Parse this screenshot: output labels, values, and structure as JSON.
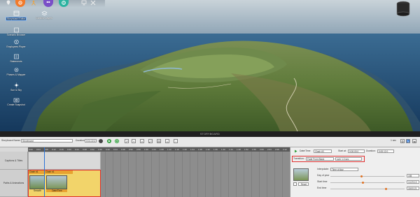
{
  "top_toolbar": {
    "buttons": [
      {
        "icon": "map-pin-icon",
        "color": "#e8e8e8"
      },
      {
        "icon": "gear-icon",
        "color": "#f27a2a"
      },
      {
        "icon": "person-icon",
        "color": "#e8a64a"
      },
      {
        "icon": "people-icon",
        "color": "#7a4fc7"
      },
      {
        "icon": "globe-icon",
        "color": "#2bb3a0"
      },
      {
        "icon": "monitor-icon",
        "color": "#e0e0e0"
      },
      {
        "icon": "tools-icon",
        "color": "#e0e0e0"
      }
    ]
  },
  "tools": [
    {
      "label": "Storyboard Editor",
      "icon": "storyboard-icon",
      "selected": true
    },
    {
      "label": "Confuse Layers",
      "icon": "layers-icon",
      "selected": false
    },
    {
      "label": "Scenario Browser",
      "icon": "browser-icon",
      "selected": false
    },
    {
      "label": "Employees Player",
      "icon": "player-icon",
      "selected": false
    },
    {
      "label": "Statements",
      "icon": "statements-icon",
      "selected": false
    },
    {
      "label": "Phases & Mapper",
      "icon": "phases-icon",
      "selected": false
    },
    {
      "label": "Sun & Sky",
      "icon": "sun-icon",
      "selected": false
    },
    {
      "label": "Create Snapshot",
      "icon": "camera-icon",
      "selected": false
    }
  ],
  "storyboard": {
    "title": "STORYBOARD",
    "name_label": "Storyboard Name:",
    "name_value": "Storyboard",
    "duration_label": "Duration:",
    "duration_value": "0:01:22.0",
    "time_value": "0:00:12.0",
    "speed_value": "1 sec",
    "right_time": "0:00:12.0"
  },
  "tracks": [
    {
      "label": "Captions & Titles"
    },
    {
      "label": "Paths & Animations"
    }
  ],
  "clips": {
    "group_label": "Clash #1",
    "clip_a_label": "Clash #1",
    "clip_b_label": "Clash #1",
    "sub_a_label": "Smooth",
    "sub_b_label": "Date/Time"
  },
  "ruler": {
    "ticks": [
      "0:00",
      "0:04",
      "0:08",
      "0:12",
      "0:16",
      "0:20",
      "0:24",
      "0:28",
      "0:32",
      "0:36",
      "0:40",
      "0:44",
      "0:48",
      "0:52",
      "0:56",
      "1:00",
      "1:04",
      "1:08",
      "1:12",
      "1:16",
      "1:20",
      "1:24",
      "1:28",
      "1:32",
      "1:36",
      "1:40",
      "1:44",
      "1:48",
      "1:52",
      "1:56",
      "2:00",
      "2:04",
      "2:08",
      "2:12"
    ]
  },
  "props": {
    "title": "Date/Time",
    "clip_name": "Clash #3",
    "start_label": "Start at:",
    "start_value": "0:00:00.0",
    "duration_label": "Duration:",
    "duration_value": "0:00:12.0",
    "transition_label": "Transition:",
    "transition_value": "Fade From Black",
    "transition_time": "over 1.0 sec",
    "interpolate_label": "Interpolate:",
    "interpolate_value": "Time of day",
    "day_label": "Day of year",
    "day_value": "155",
    "start_time_label": "Start time",
    "start_time_value": "10:29:13",
    "end_time_label": "End time",
    "end_time_value": "18:00:21",
    "reset_label": "Reset",
    "day_fraction": 0.42,
    "start_fraction": 0.44,
    "end_fraction": 0.75
  },
  "colors": {
    "accent_blue": "#2a73d8",
    "highlight_red": "#e03030",
    "clip_yellow": "#f2d46a",
    "clip_orange": "#e8a230",
    "play_green": "#2e9e3a"
  }
}
